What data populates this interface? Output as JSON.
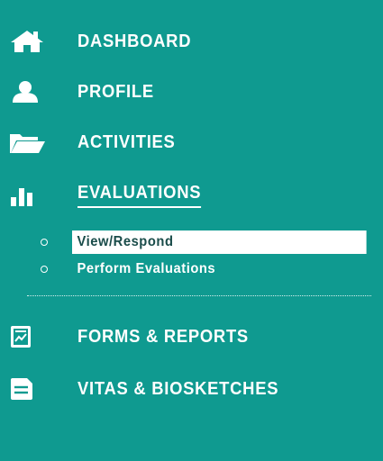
{
  "nav": {
    "items": [
      {
        "label": "DASHBOARD",
        "icon": "home-icon"
      },
      {
        "label": "PROFILE",
        "icon": "user-icon"
      },
      {
        "label": "ACTIVITIES",
        "icon": "folder-open-icon"
      },
      {
        "label": "EVALUATIONS",
        "icon": "bar-chart-icon",
        "active": true
      },
      {
        "label": "FORMS & REPORTS",
        "icon": "report-icon"
      },
      {
        "label": "VITAS & BIOSKETCHES",
        "icon": "document-icon"
      }
    ],
    "evaluations_submenu": [
      {
        "label": "View/Respond",
        "selected": true
      },
      {
        "label": "Perform Evaluations",
        "selected": false
      }
    ]
  },
  "colors": {
    "background": "#0f9a90",
    "text": "#ffffff",
    "selected_text": "#1a4c4a"
  }
}
